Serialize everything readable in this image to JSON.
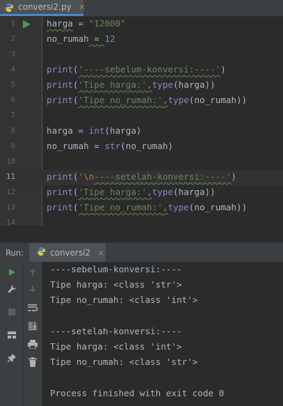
{
  "editor_tab": {
    "filename": "conversi2.py",
    "close": "×"
  },
  "code_lines": [
    {
      "n": "1",
      "tokens": [
        {
          "t": "harga",
          "c": "id",
          "sq": true
        },
        {
          "t": " = ",
          "c": "id"
        },
        {
          "t": "\"12000\"",
          "c": "str"
        }
      ]
    },
    {
      "n": "2",
      "tokens": [
        {
          "t": "no_rumah",
          "c": "id"
        },
        {
          "t": " = ",
          "c": "id",
          "sq": true
        },
        {
          "t": "12",
          "c": "num-lit"
        }
      ]
    },
    {
      "n": "3",
      "tokens": []
    },
    {
      "n": "4",
      "tokens": [
        {
          "t": "print",
          "c": "fn"
        },
        {
          "t": "(",
          "c": "id"
        },
        {
          "t": "'----sebelum-konversi:----'",
          "c": "str",
          "sq": true
        },
        {
          "t": ")",
          "c": "id"
        }
      ]
    },
    {
      "n": "5",
      "tokens": [
        {
          "t": "print",
          "c": "fn"
        },
        {
          "t": "(",
          "c": "id"
        },
        {
          "t": "'Tipe harga:'",
          "c": "str",
          "sq": true
        },
        {
          "t": ",",
          "c": "kw",
          "sq": true
        },
        {
          "t": "type",
          "c": "fn"
        },
        {
          "t": "(harga))",
          "c": "id"
        }
      ]
    },
    {
      "n": "6",
      "tokens": [
        {
          "t": "print",
          "c": "fn"
        },
        {
          "t": "(",
          "c": "id"
        },
        {
          "t": "'Tipe no_rumah:'",
          "c": "str",
          "sq": true
        },
        {
          "t": ",",
          "c": "kw",
          "sq": true
        },
        {
          "t": "type",
          "c": "fn"
        },
        {
          "t": "(no_rumah))",
          "c": "id"
        }
      ]
    },
    {
      "n": "7",
      "tokens": []
    },
    {
      "n": "8",
      "tokens": [
        {
          "t": "harga",
          "c": "id"
        },
        {
          "t": " = ",
          "c": "id"
        },
        {
          "t": "int",
          "c": "fn"
        },
        {
          "t": "(harga)",
          "c": "id"
        }
      ]
    },
    {
      "n": "9",
      "tokens": [
        {
          "t": "no_rumah",
          "c": "id"
        },
        {
          "t": " = ",
          "c": "id"
        },
        {
          "t": "str",
          "c": "fn"
        },
        {
          "t": "(no_rumah)",
          "c": "id"
        }
      ]
    },
    {
      "n": "10",
      "tokens": []
    },
    {
      "n": "11",
      "current": true,
      "tokens": [
        {
          "t": "print",
          "c": "fn"
        },
        {
          "t": "(",
          "c": "id"
        },
        {
          "t": "'",
          "c": "str"
        },
        {
          "t": "\\n",
          "c": "esc"
        },
        {
          "t": "----setelah-konversi:----'",
          "c": "str",
          "sq": true
        },
        {
          "t": ")",
          "c": "id"
        }
      ]
    },
    {
      "n": "12",
      "tokens": [
        {
          "t": "print",
          "c": "fn"
        },
        {
          "t": "(",
          "c": "id"
        },
        {
          "t": "'Tipe harga:'",
          "c": "str",
          "sq": true
        },
        {
          "t": ",",
          "c": "kw",
          "sq": true
        },
        {
          "t": "type",
          "c": "fn"
        },
        {
          "t": "(harga))",
          "c": "id"
        }
      ]
    },
    {
      "n": "13",
      "tokens": [
        {
          "t": "print",
          "c": "fn"
        },
        {
          "t": "(",
          "c": "id"
        },
        {
          "t": "'Tipe no_rumah:'",
          "c": "str",
          "sq": true
        },
        {
          "t": ",",
          "c": "kw",
          "sq": true
        },
        {
          "t": "type",
          "c": "fn"
        },
        {
          "t": "(no_rumah))",
          "c": "id"
        }
      ]
    },
    {
      "n": "14",
      "tokens": []
    }
  ],
  "run_panel": {
    "title": "Run:",
    "config_name": "conversi2",
    "close": "×",
    "output": [
      "----sebelum-konversi:----",
      "Tipe harga: <class 'str'>",
      "Tipe no_rumah: <class 'int'>",
      "",
      "----setelah-konversi:----",
      "Tipe harga: <class 'int'>",
      "Tipe no_rumah: <class 'str'>",
      "",
      "Process finished with exit code 0"
    ]
  },
  "colors": {
    "background": "#2b2b2b",
    "string": "#6a8759",
    "number": "#6897bb",
    "builtin": "#8888c6",
    "keyword": "#cc7832",
    "run_green": "#499c54"
  }
}
